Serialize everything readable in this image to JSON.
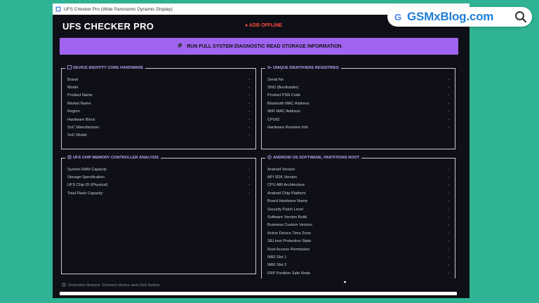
{
  "window_title": "UFS Checker Pro (Wide Panoramic Dynamic Display)",
  "app_title": "UFS CHECKER PRO",
  "adb_status": "● ADB OFFLINE",
  "run_button": {
    "icon": "rocket-icon",
    "label": "RUN FULL SYSTEM DIAGNOSTIC  READ STORAGE INFORMATION"
  },
  "panels": {
    "device": {
      "title": "DEVICE IDENTITY  CORE HARDWARE",
      "icon": "box-icon",
      "rows": [
        {
          "label": "Brand",
          "value": "-"
        },
        {
          "label": "Model",
          "value": "-"
        },
        {
          "label": "Product Name",
          "value": "-"
        },
        {
          "label": "Market Name",
          "value": "-"
        },
        {
          "label": "Region",
          "value": "-"
        },
        {
          "label": "Hardware Block",
          "value": "-"
        },
        {
          "label": "SoC Manufacturer",
          "value": "-"
        },
        {
          "label": "SoC Model",
          "value": "-"
        }
      ]
    },
    "identifiers": {
      "title": "UNIQUE IDENTIFIERS  REGISTRIES",
      "icon": "key-icon",
      "rows": [
        {
          "label": "Serial No",
          "value": "-"
        },
        {
          "label": "SNO (Bootloader)",
          "value": "-"
        },
        {
          "label": "Product PSN Code",
          "value": "-"
        },
        {
          "label": "Bluetooth MAC Address",
          "value": "-"
        },
        {
          "label": "WiFi MAC Address",
          "value": "-"
        },
        {
          "label": "CPUID",
          "value": "-"
        },
        {
          "label": "Hardware Revision Info",
          "value": "-"
        }
      ]
    },
    "ufs": {
      "title": "UFS CHIP  MEMORY CONTROLLER ANALYSIS",
      "icon": "chip-icon",
      "rows": [
        {
          "label": "System RAM Capacity",
          "value": "-"
        },
        {
          "label": "Storage Specification",
          "value": "-"
        },
        {
          "label": "UFS Chip ID (Physical)",
          "value": "-"
        },
        {
          "label": "Total Flash Capacity",
          "value": "-"
        }
      ]
    },
    "android": {
      "title": "ANDROID OS SOFTWARE, PARTITIONS  ROOT",
      "icon": "android-icon",
      "rows": [
        {
          "label": "Android Version",
          "value": "-"
        },
        {
          "label": "API SDK Version",
          "value": "-"
        },
        {
          "label": "CPU ABI Architecture",
          "value": "-"
        },
        {
          "label": "Android Chip Platform",
          "value": "-"
        },
        {
          "label": "Board Hardware Name",
          "value": "-"
        },
        {
          "label": "Security Patch Level",
          "value": "-"
        },
        {
          "label": "Software Version Build",
          "value": "-"
        },
        {
          "label": "Business Custom Version",
          "value": "-"
        },
        {
          "label": "Active Device Time Zone",
          "value": "-"
        },
        {
          "label": "SELinux Protection State",
          "value": "-"
        },
        {
          "label": "Root Access Permission",
          "value": "-"
        },
        {
          "label": "IMEI Slot 1",
          "value": "-"
        },
        {
          "label": "IMEI Slot 2",
          "value": "-"
        },
        {
          "label": "FRP Partition Safe Node",
          "value": "-"
        }
      ]
    }
  },
  "footer_status": "Detection timeout. Connect device and click button.",
  "watermark": {
    "brand": "GSMxBlog.com",
    "g_letter": "G"
  },
  "colors": {
    "background": "#2fb394",
    "window": "#0f1017",
    "accent_button": "#a064f0",
    "panel_title": "#b7a3ee",
    "offline": "#ff4a3d"
  }
}
